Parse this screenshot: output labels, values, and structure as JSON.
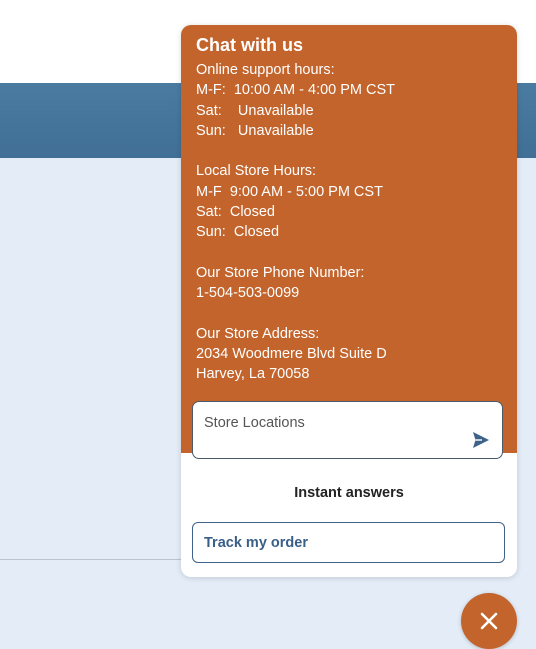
{
  "chat": {
    "title": "Chat with us",
    "info_lines": [
      "Online support hours:",
      "M-F:  10:00 AM - 4:00 PM CST",
      "Sat:    Unavailable",
      "Sun:   Unavailable",
      "",
      "Local Store Hours:",
      "M-F  9:00 AM - 5:00 PM CST",
      "Sat:  Closed",
      "Sun:  Closed",
      "",
      "Our Store Phone Number:",
      "1-504-503-0099",
      "",
      "Our Store Address:",
      "2034 Woodmere Blvd Suite D",
      "Harvey, La 70058"
    ],
    "message_input": {
      "value": "",
      "placeholder": "Store Locations"
    },
    "instant_answers_heading": "Instant answers",
    "instant_answers": [
      "Track my order"
    ]
  },
  "icons": {
    "send": "send-icon",
    "close": "close-icon"
  },
  "colors": {
    "accent": "#c2642c",
    "banner": "#4a7ba1",
    "page_bg": "#e3ecf7",
    "link": "#3a5f87"
  }
}
